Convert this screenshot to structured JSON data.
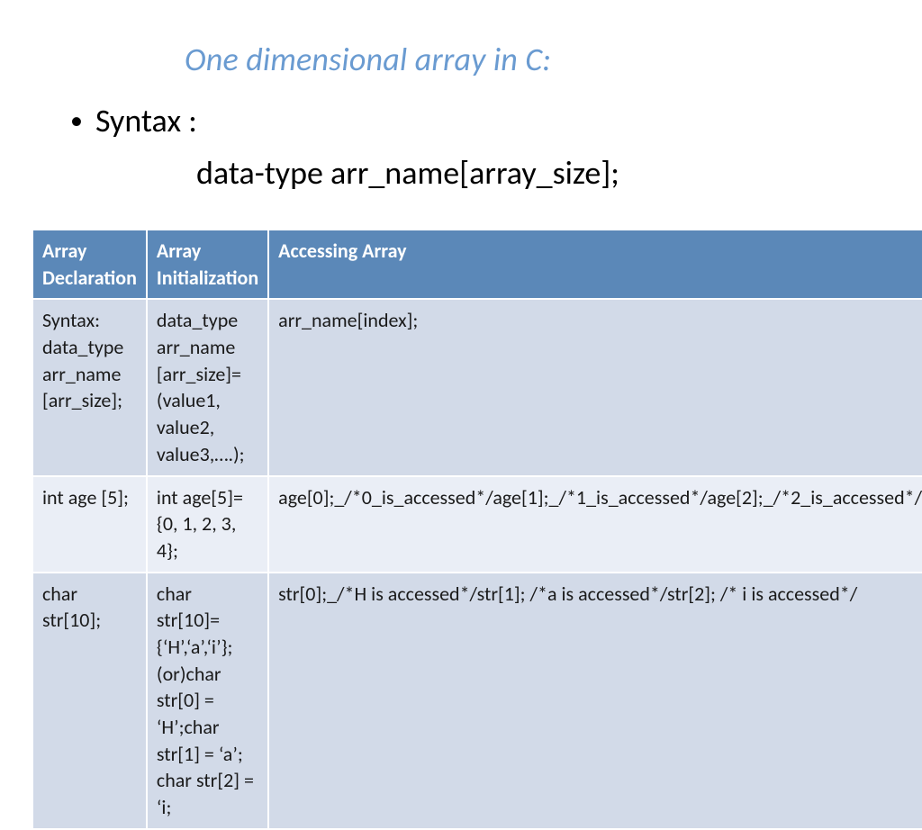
{
  "title": "One dimensional array in C:",
  "bullet": {
    "label": "Syntax :"
  },
  "syntax_line": "data-type  arr_name[array_size];",
  "table": {
    "headers": {
      "c1": "Array Declaration",
      "c2": "Array Initialization",
      "c3": "Accessing Array"
    },
    "rows": [
      {
        "c1": "Syntax: data_type arr_name [arr_size];",
        "c2": "data_type arr_name [arr_size]=(value1, value2, value3,….);",
        "c3": "arr_name[index];"
      },
      {
        "c1": "int age [5];",
        "c2": "int age[5]={0, 1, 2, 3, 4};",
        "c3": "age[0];_/*0_is_accessed*/age[1];_/*1_is_accessed*/age[2];_/*2_is_accessed*/"
      },
      {
        "c1": "char str[10];",
        "c2": "char str[10]={‘H’,‘a’,‘i’}; (or)char str[0] = ‘H’;char str[1] = ‘a’; char str[2] = ‘i;",
        "c3": "str[0];_/*H is accessed*/str[1];  /*a is accessed*/str[2];  /* i is accessed*/"
      }
    ]
  }
}
